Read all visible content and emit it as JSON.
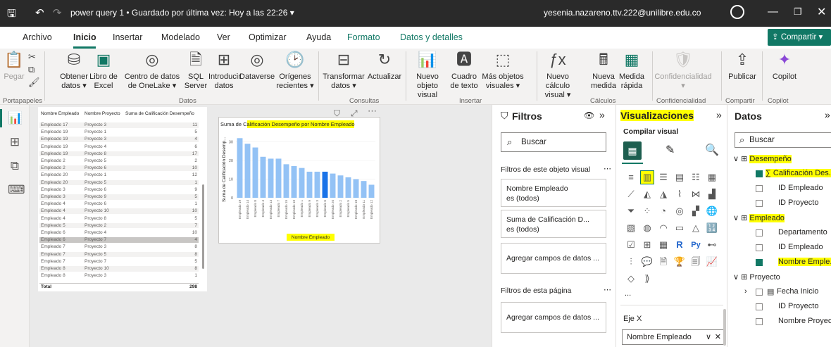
{
  "titlebar": {
    "doc_title": "power query 1 • Guardado por última vez: Hoy a las 22:26 ▾",
    "user": "yesenia.nazareno.ttv.222@unilibre.edu.co"
  },
  "menu": {
    "tabs": [
      "Archivo",
      "Inicio",
      "Insertar",
      "Modelado",
      "Ver",
      "Optimizar",
      "Ayuda",
      "Formato",
      "Datos y detalles"
    ],
    "share": "Compartir"
  },
  "ribbon": {
    "buttons": {
      "pegar": "Pegar",
      "obtener": "Obtener datos ▾",
      "excel": "Libro de Excel",
      "onelake": "Centro de datos de OneLake ▾",
      "sql": "SQL Server",
      "introducir": "Introducir datos",
      "dataverse": "Dataverse",
      "origenes": "Orígenes recientes ▾",
      "transformar": "Transformar datos ▾",
      "actualizar": "Actualizar",
      "nuevo_objeto": "Nuevo objeto visual",
      "cuadro": "Cuadro de texto",
      "mas": "Más objetos visuales ▾",
      "nuevo_calculo": "Nuevo cálculo visual ▾",
      "nueva_medida": "Nueva medida",
      "medida_rapida": "Medida rápida",
      "confidencialidad": "Confidencialidad ▾",
      "publicar": "Publicar",
      "copilot": "Copilot"
    },
    "groups": [
      "Portapapeles",
      "Datos",
      "Consultas",
      "Insertar",
      "Cálculos",
      "Confidencialidad",
      "Compartir",
      "Copilot"
    ]
  },
  "table": {
    "headers": [
      "Nombre Empleado",
      "Nombre Proyecto",
      "Suma de Calificación Desempeño"
    ],
    "rows": [
      [
        "Empleado 17",
        "Proyecto 3",
        "11"
      ],
      [
        "Empleado 19",
        "Proyecto 1",
        "5"
      ],
      [
        "Empleado 19",
        "Proyecto 3",
        "4"
      ],
      [
        "Empleado 19",
        "Proyecto 4",
        "6"
      ],
      [
        "Empleado 19",
        "Proyecto 8",
        "17"
      ],
      [
        "Empleado 2",
        "Proyecto 5",
        "2"
      ],
      [
        "Empleado 2",
        "Proyecto 6",
        "10"
      ],
      [
        "Empleado 20",
        "Proyecto 1",
        "12"
      ],
      [
        "Empleado 20",
        "Proyecto 5",
        "1"
      ],
      [
        "Empleado 3",
        "Proyecto 6",
        "9"
      ],
      [
        "Empleado 3",
        "Proyecto 9",
        "5"
      ],
      [
        "Empleado 4",
        "Proyecto 6",
        "1"
      ],
      [
        "Empleado 4",
        "Proyecto 10",
        "10"
      ],
      [
        "Empleado 4",
        "Proyecto 8",
        "5"
      ],
      [
        "Empleado 5",
        "Proyecto 2",
        "7"
      ],
      [
        "Empleado 6",
        "Proyecto 4",
        "10"
      ],
      [
        "Empleado 6",
        "Proyecto 7",
        "4"
      ],
      [
        "Empleado 7",
        "Proyecto 3",
        "8"
      ],
      [
        "Empleado 7",
        "Proyecto 5",
        "8"
      ],
      [
        "Empleado 7",
        "Proyecto 7",
        "5"
      ],
      [
        "Empleado 8",
        "Proyecto 10",
        "8"
      ],
      [
        "Empleado 8",
        "Proyecto 3",
        "1"
      ]
    ],
    "total_label": "Total",
    "total_value": "298"
  },
  "chart_data": {
    "type": "bar",
    "title": "Suma de Calificación Desempeño por Nombre Empleado",
    "xlabel": "Nombre Empleado",
    "ylabel": "Suma de Calificación Desemp...",
    "ylim": [
      0,
      34
    ],
    "yticks": [
      0,
      10,
      20,
      30
    ],
    "categories": [
      "Empleado 19",
      "Empleado 14",
      "Empleado 8",
      "Empleado 4",
      "Empleado 13",
      "Empleado 7",
      "Empleado 15",
      "Empleado 10",
      "Empleado 1",
      "Empleado 9",
      "Empleado 3",
      "Empleado 6",
      "Empleado 20",
      "Empleado 2",
      "Empleado 5",
      "Empleado 18",
      "Empleado 11",
      "Empleado 12"
    ],
    "values": [
      32,
      29,
      27,
      22,
      21,
      21,
      18,
      17,
      16,
      14,
      14,
      14,
      13,
      12,
      11,
      10,
      9,
      7
    ],
    "highlight_index": 11,
    "bar_color": "#93c2f5",
    "highlight_color": "#1a73e8"
  },
  "filters": {
    "title": "Filtros",
    "search": "Buscar",
    "section_visual": "Filtros de este objeto visual",
    "card1_title": "Nombre Empleado",
    "card1_value": "es (todos)",
    "card2_title": "Suma de Calificación D...",
    "card2_value": "es (todos)",
    "add_fields": "Agregar campos de datos ...",
    "section_page": "Filtros de esta página",
    "more": "..."
  },
  "visualizations": {
    "title": "Visualizaciones",
    "build": "Compilar visual",
    "more": "...",
    "eje_x": "Eje X",
    "eje_x_field": "Nombre Empleado"
  },
  "data_pane": {
    "title": "Datos",
    "search": "Buscar",
    "tables": [
      {
        "name": "Desempeño",
        "fields": [
          "∑ Calificación Des...",
          "ID Empleado",
          "ID Proyecto"
        ]
      },
      {
        "name": "Empleado",
        "fields": [
          "Departamento",
          "ID Empleado",
          "Nombre Emple..."
        ]
      },
      {
        "name": "Proyecto",
        "fields": [
          "Fecha Inicio",
          "ID Proyecto",
          "Nombre Proyec..."
        ]
      }
    ]
  }
}
